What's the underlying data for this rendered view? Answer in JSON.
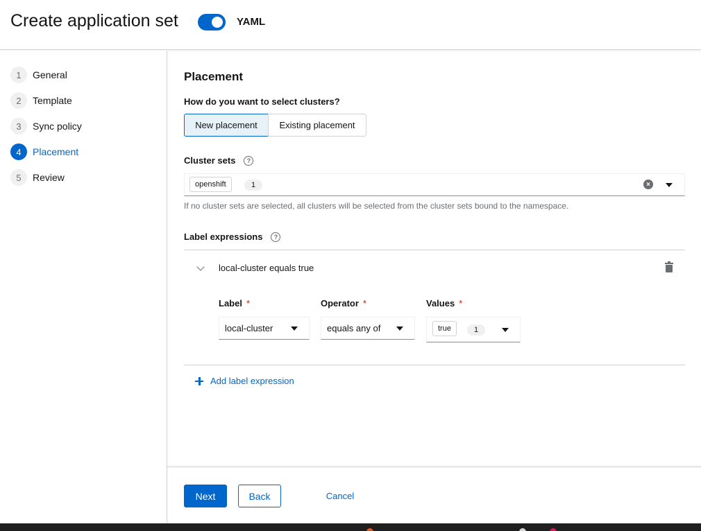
{
  "header": {
    "title": "Create application set",
    "yaml_toggle_label": "YAML",
    "yaml_toggle_on": true
  },
  "wizard_nav": {
    "steps": [
      {
        "number": "1",
        "label": "General",
        "active": false
      },
      {
        "number": "2",
        "label": "Template",
        "active": false
      },
      {
        "number": "3",
        "label": "Sync policy",
        "active": false
      },
      {
        "number": "4",
        "label": "Placement",
        "active": true
      },
      {
        "number": "5",
        "label": "Review",
        "active": false
      }
    ]
  },
  "placement": {
    "section_title": "Placement",
    "question": "How do you want to select clusters?",
    "options": {
      "new": "New placement",
      "existing": "Existing placement",
      "selected": "new"
    },
    "cluster_sets": {
      "label": "Cluster sets",
      "chip": "openshift",
      "count": "1",
      "helper_text": "If no cluster sets are selected, all clusters will be selected from the cluster sets bound to the namespace."
    },
    "label_expressions": {
      "label": "Label expressions",
      "items": [
        {
          "title": "local-cluster equals true",
          "label_field": {
            "label": "Label",
            "value": "local-cluster"
          },
          "operator_field": {
            "label": "Operator",
            "value": "equals any of"
          },
          "values_field": {
            "label": "Values",
            "chip": "true",
            "count": "1"
          }
        }
      ],
      "add_label": "Add label expression"
    }
  },
  "footer": {
    "next": "Next",
    "back": "Back",
    "cancel": "Cancel"
  },
  "colors": {
    "accent": "#0066cc",
    "required": "#c9190b",
    "border": "#d2d2d2"
  }
}
